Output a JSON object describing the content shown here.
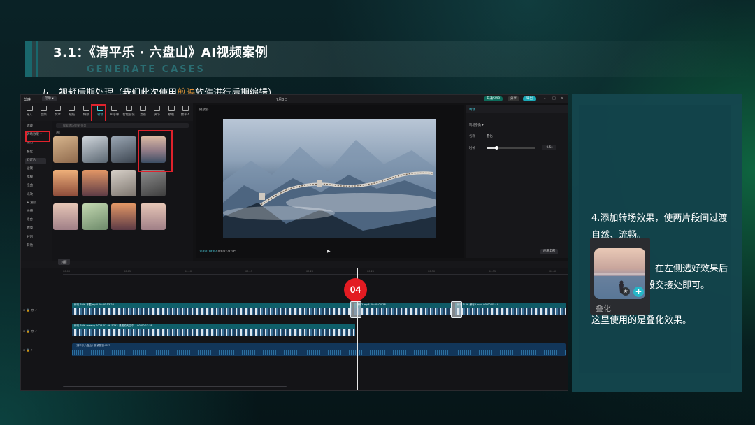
{
  "slide": {
    "title": "3.1：《清平乐 · 六盘山》AI视频案例",
    "subtitle": "GENERATE CASES",
    "step_prefix": "五、视频后期处理（我们此次使用",
    "step_highlight": "剪映",
    "step_suffix": "软件进行后期编辑）",
    "highlight_color": "#f39a3a"
  },
  "app": {
    "logo": "剪映",
    "menu_label": "菜单 ▾",
    "date_title": "7月8日",
    "pro_label": "开通SVIP",
    "share_label": "分享",
    "export_label": "导出",
    "toolbar": [
      {
        "label": "导入",
        "active": false
      },
      {
        "label": "音频",
        "active": false
      },
      {
        "label": "文本",
        "active": false
      },
      {
        "label": "贴纸",
        "active": false
      },
      {
        "label": "特效",
        "active": false
      },
      {
        "label": "转场",
        "active": true
      },
      {
        "label": "AI字幕",
        "active": false
      },
      {
        "label": "智能包装",
        "active": false
      },
      {
        "label": "滤镜",
        "active": false
      },
      {
        "label": "调节",
        "active": false
      },
      {
        "label": "模板",
        "active": false
      },
      {
        "label": "数字人",
        "active": false
      }
    ],
    "sidebar": [
      "收藏",
      "转场效果 ▾",
      "热门",
      "叠化",
      "幻灯片",
      "运镜",
      "模糊",
      "扭曲",
      "光效",
      "✦ 潮流",
      "拍摄",
      "组合",
      "故障",
      "分割",
      "其他"
    ],
    "search_placeholder": "搜索转场效果/分类",
    "hot_label": "热门",
    "thumbs": [
      "推近拉远",
      "撕纸",
      "雾化",
      "叠化",
      "云雾",
      "逆光",
      "模糊推近",
      "渐变过渡",
      "翻页",
      "摇摆",
      "立方翻转",
      "旋转过渡"
    ],
    "preview_label": "播放器",
    "current_time": "00:00:14:02",
    "total_time": "00:00:40:05",
    "props_tab": "转场",
    "props_section": "转场参数 ▾",
    "props_name_label": "名称",
    "props_name_value": "叠化",
    "props_duration_label": "时长",
    "props_duration_value": "0.5s",
    "props_duration_fraction": 0.2,
    "apply_all_label": "应用全部",
    "cover_label": "封面",
    "ruler": [
      "00:00",
      "00:05",
      "00:10",
      "00:15",
      "00:20",
      "00:25",
      "00:30",
      "00:35",
      "00:40"
    ],
    "track1_clips": [
      "修改 3.46   下載.mp4   00:00:13:28",
      "瀑布2.mp4   00:00:04:26",
      "修改 3.56   瀑布3.mp4   00:00:05:19"
    ],
    "track2_clip": "修改 3.46   meeng-2025-07-06-5793-清晨的天空中…  00:00:13:28",
    "audio_clip": "《清平乐六盘山》朗诵配音.MP3",
    "badge": "04"
  },
  "info": {
    "p1": "4.添加转场效果，使两片段间过渡自然、流畅。",
    "p2": "具体使用方法：在左侧选好效果后直接拖入两片段交接处即可。",
    "p3": "这里使用的是叠化效果。",
    "card_label": "叠化"
  }
}
